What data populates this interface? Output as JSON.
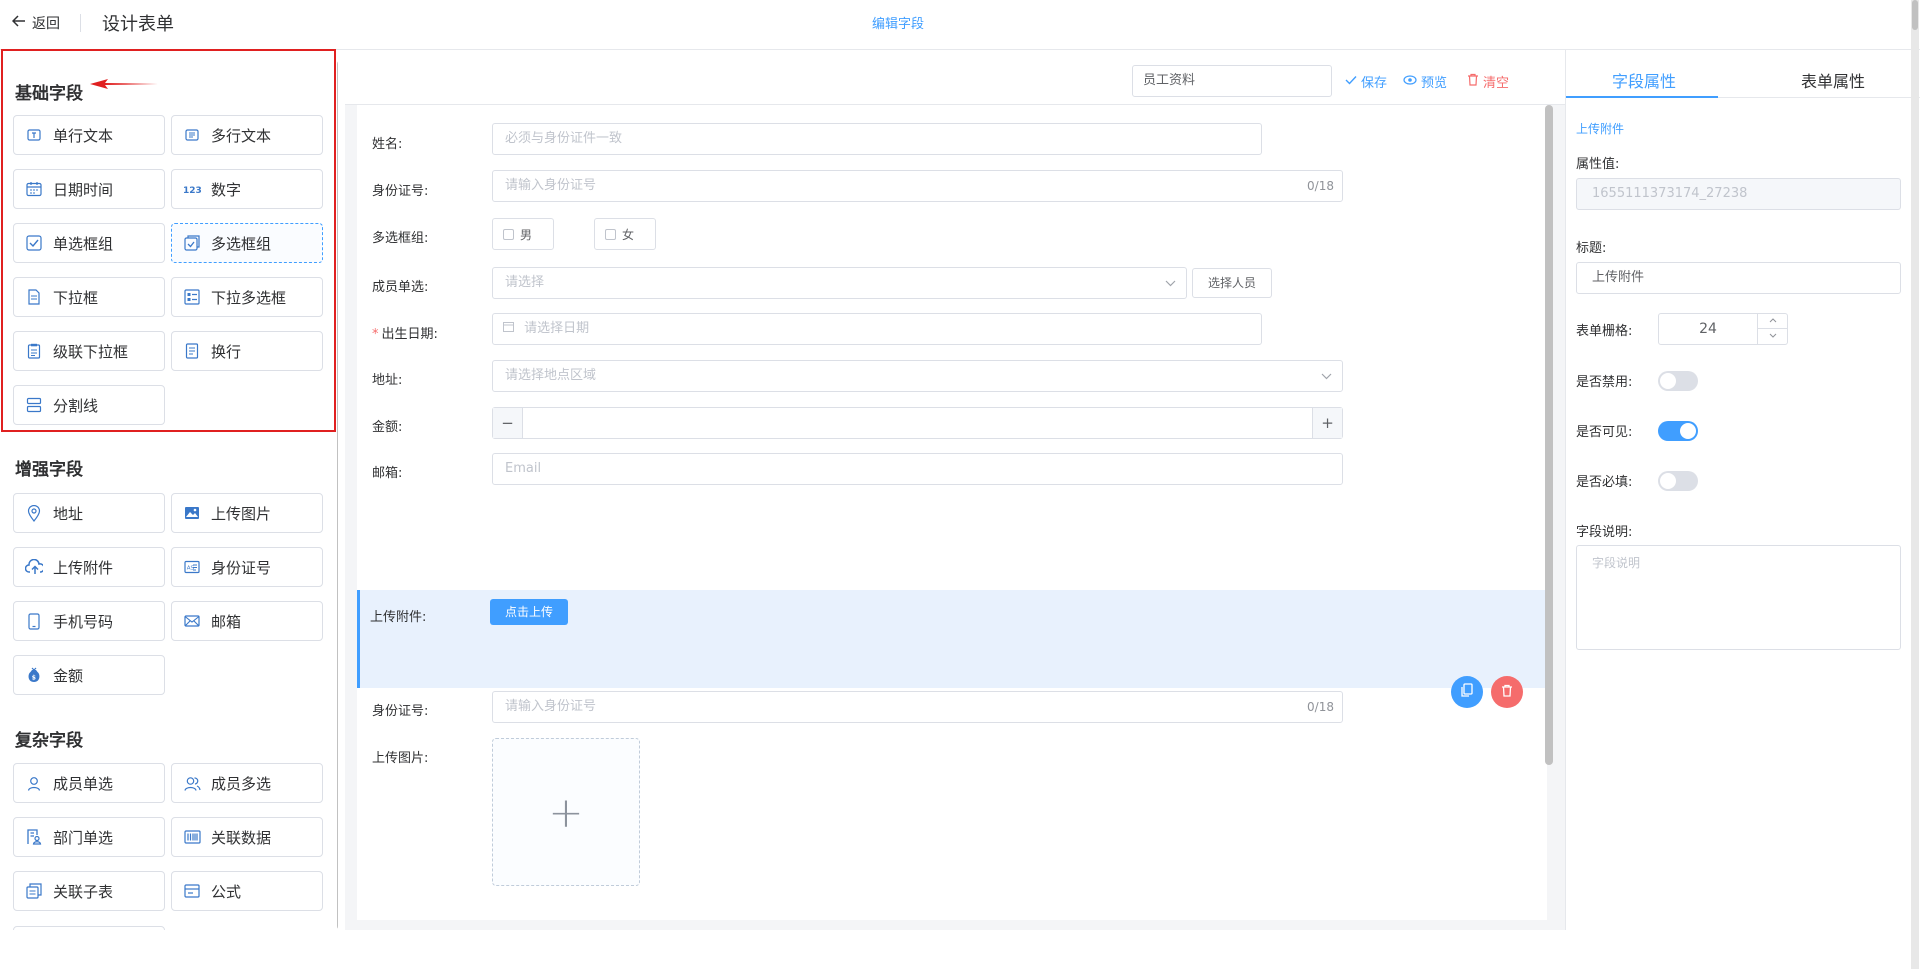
{
  "header": {
    "back_label": "返回",
    "title": "设计表单",
    "tab": "编辑字段"
  },
  "palette": {
    "basic_title": "基础字段",
    "basic": [
      {
        "label": "单行文本",
        "icon": "single-line-text-icon"
      },
      {
        "label": "多行文本",
        "icon": "multi-line-text-icon"
      },
      {
        "label": "日期时间",
        "icon": "calendar-icon"
      },
      {
        "label": "数字",
        "icon": "number-icon"
      },
      {
        "label": "单选框组",
        "icon": "radio-group-icon"
      },
      {
        "label": "多选框组",
        "icon": "checkbox-group-icon"
      },
      {
        "label": "下拉框",
        "icon": "dropdown-icon"
      },
      {
        "label": "下拉多选框",
        "icon": "multi-dropdown-icon"
      },
      {
        "label": "级联下拉框",
        "icon": "cascader-icon"
      },
      {
        "label": "换行",
        "icon": "line-break-icon"
      },
      {
        "label": "分割线",
        "icon": "divider-icon"
      }
    ],
    "enhanced_title": "增强字段",
    "enhanced": [
      {
        "label": "地址",
        "icon": "location-icon"
      },
      {
        "label": "上传图片",
        "icon": "image-icon"
      },
      {
        "label": "上传附件",
        "icon": "cloud-upload-icon"
      },
      {
        "label": "身份证号",
        "icon": "id-card-icon"
      },
      {
        "label": "手机号码",
        "icon": "phone-icon"
      },
      {
        "label": "邮箱",
        "icon": "mail-icon"
      },
      {
        "label": "金额",
        "icon": "money-bag-icon"
      }
    ],
    "complex_title": "复杂字段",
    "complex": [
      {
        "label": "成员单选",
        "icon": "user-icon"
      },
      {
        "label": "成员多选",
        "icon": "users-icon"
      },
      {
        "label": "部门单选",
        "icon": "department-icon"
      },
      {
        "label": "关联数据",
        "icon": "barcode-icon"
      },
      {
        "label": "关联子表",
        "icon": "sub-table-icon"
      },
      {
        "label": "公式",
        "icon": "formula-icon"
      }
    ]
  },
  "toolbar": {
    "form_name": "员工资料",
    "save": "保存",
    "preview": "预览",
    "clear": "清空"
  },
  "form": {
    "name_label": "姓名:",
    "name_placeholder": "必须与身份证件一致",
    "id_label": "身份证号:",
    "id_placeholder": "请输入身份证号",
    "id_counter": "0/18",
    "checkbox_label": "多选框组:",
    "checkbox_options": [
      "男",
      "女"
    ],
    "member_label": "成员单选:",
    "member_placeholder": "请选择",
    "member_button": "选择人员",
    "birth_label": "出生日期:",
    "birth_required_mark": "*",
    "birth_placeholder": "请选择日期",
    "address_label": "地址:",
    "address_placeholder": "请选择地点区域",
    "amount_label": "金额:",
    "amount_minus": "−",
    "amount_plus": "+",
    "email_label": "邮箱:",
    "email_placeholder": "Email",
    "attach_label": "上传附件:",
    "attach_button": "点击上传",
    "id2_label": "身份证号:",
    "id2_placeholder": "请输入身份证号",
    "id2_counter": "0/18",
    "image_label": "上传图片:",
    "image_plus": "+"
  },
  "props": {
    "tab_field": "字段属性",
    "tab_form": "表单属性",
    "section": "上传附件",
    "value_label": "属性值:",
    "value": "1655111373174_27238",
    "title_label": "标题:",
    "title": "上传附件",
    "grid_label": "表单栅格:",
    "grid_value": "24",
    "disabled_label": "是否禁用:",
    "disabled": false,
    "visible_label": "是否可见:",
    "visible": true,
    "required_label": "是否必填:",
    "required": false,
    "desc_label": "字段说明:",
    "desc_placeholder": "字段说明"
  },
  "colors": {
    "accent": "#409eff",
    "danger": "#f56c6c",
    "annotation": "#e02020"
  }
}
